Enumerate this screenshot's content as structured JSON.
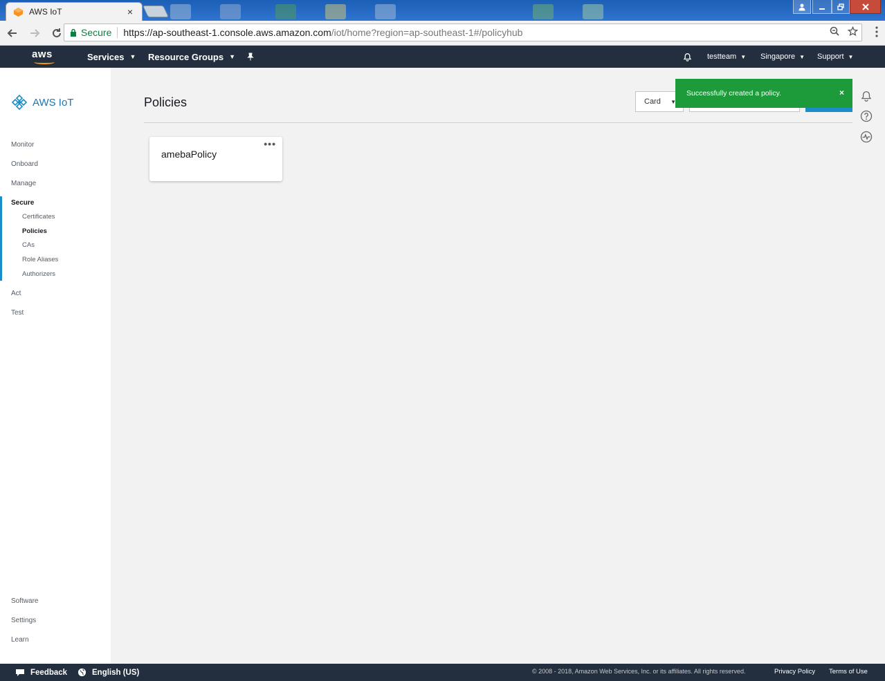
{
  "browser": {
    "tab_title": "AWS IoT",
    "tab_close": "×",
    "secure_label": "Secure",
    "url_host": "https://ap-southeast-1.console.aws.amazon.com",
    "url_path": "/iot/home?region=ap-southeast-1#/policyhub",
    "icons": [
      "back-icon",
      "forward-icon",
      "reload-icon",
      "lock-icon",
      "zoom-icon",
      "star-icon",
      "menu-icon"
    ]
  },
  "awsnav": {
    "logo": "aws",
    "services": "Services",
    "resource_groups": "Resource Groups",
    "account": "testteam",
    "region": "Singapore",
    "support": "Support"
  },
  "sidebar": {
    "brand": "AWS IoT",
    "items": [
      {
        "label": "Monitor"
      },
      {
        "label": "Onboard"
      },
      {
        "label": "Manage"
      },
      {
        "label": "Secure",
        "active": true
      },
      {
        "label": "Act"
      },
      {
        "label": "Test"
      }
    ],
    "secure_subitems": [
      {
        "label": "Certificates"
      },
      {
        "label": "Policies",
        "active": true
      },
      {
        "label": "CAs"
      },
      {
        "label": "Role Aliases"
      },
      {
        "label": "Authorizers"
      }
    ],
    "bottom_items": [
      {
        "label": "Software"
      },
      {
        "label": "Settings"
      },
      {
        "label": "Learn"
      }
    ]
  },
  "main": {
    "title": "Policies",
    "view_select": "Card",
    "policies": [
      {
        "name": "amebaPolicy"
      }
    ]
  },
  "toast": {
    "message": "Successfully created a policy.",
    "close": "×"
  },
  "footer": {
    "feedback": "Feedback",
    "language": "English (US)",
    "copyright": "© 2008 - 2018, Amazon Web Services, Inc. or its affiliates. All rights reserved.",
    "privacy": "Privacy Policy",
    "terms": "Terms of Use"
  },
  "colors": {
    "aws_nav": "#232f3e",
    "accent": "#1b8dc9",
    "success": "#1d9b3b",
    "aws_orange": "#ff9900"
  }
}
